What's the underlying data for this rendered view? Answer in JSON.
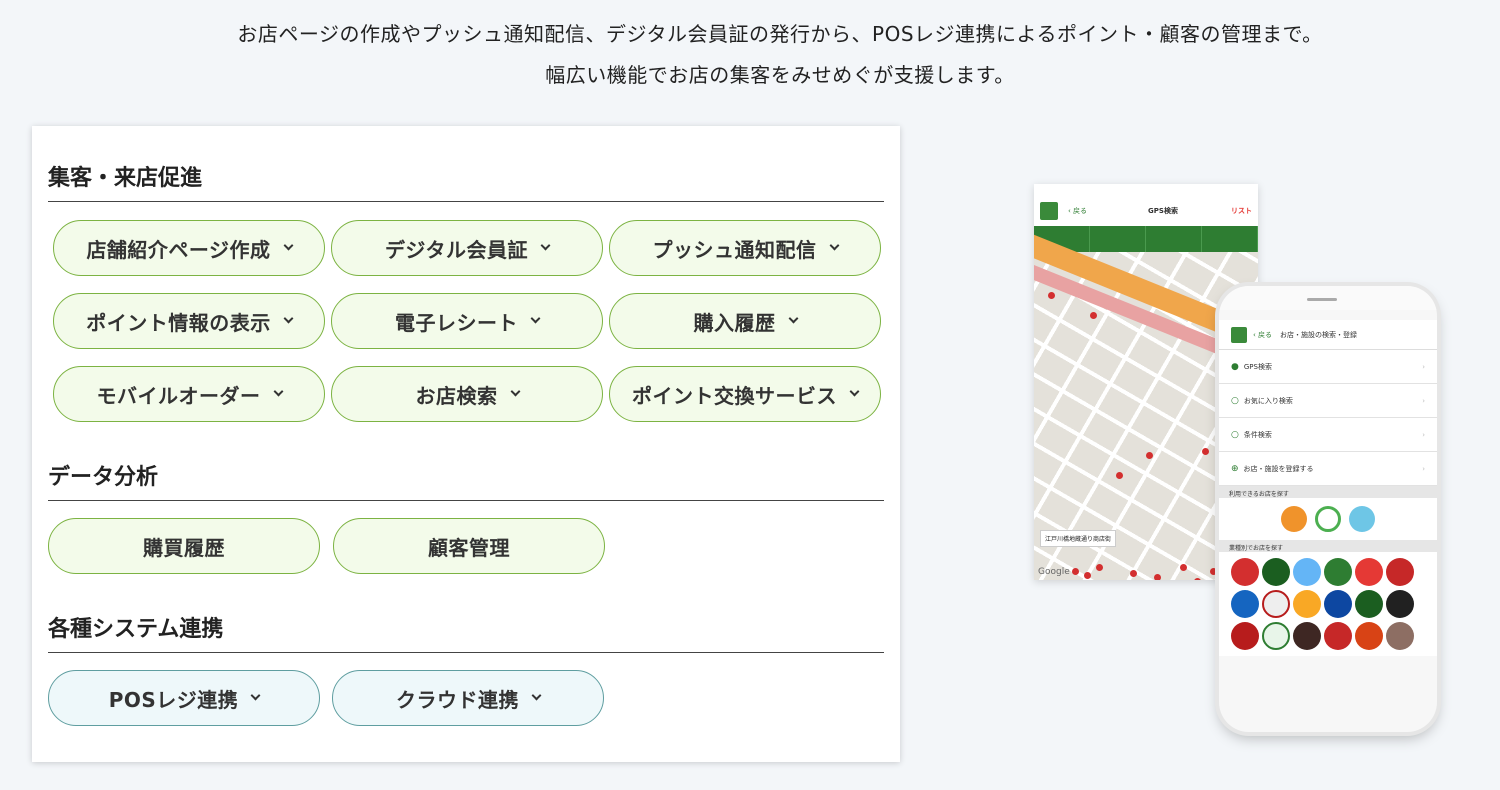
{
  "intro": {
    "line1": "お店ページの作成やプッシュ通知配信、デジタル会員証の発行から、POSレジ連携によるポイント・顧客の管理まで。",
    "line2": "幅広い機能でお店の集客をみせめぐが支援します。"
  },
  "sections": {
    "attract": {
      "title": "集客・来店促進",
      "items": [
        "店舗紹介ページ作成",
        "デジタル会員証",
        "プッシュ通知配信",
        "ポイント情報の表示",
        "電子レシート",
        "購入履歴",
        "モバイルオーダー",
        "お店検索",
        "ポイント交換サービス"
      ]
    },
    "analytics": {
      "title": "データ分析",
      "items": [
        "購買履歴",
        "顧客管理"
      ]
    },
    "integration": {
      "title": "各種システム連携",
      "items": [
        "POSレジ連携",
        "クラウド連携"
      ]
    }
  },
  "phone1": {
    "title": "GPS検索",
    "back": "戻る",
    "list": "リスト",
    "map_label": "江戸川橋地蔵通り商店街",
    "map_credit": "Google"
  },
  "phone2": {
    "back": "戻る",
    "title": "お店・施設の検索・登録",
    "rows": [
      "GPS検索",
      "お気に入り検索",
      "条件検索",
      "お店・施設を登録する"
    ],
    "section_payments": "利用できるお店を探す",
    "section_brands": "業種別でお店を探す"
  },
  "colors": {
    "pill_green_border": "#7cb342",
    "pill_green_bg": "#f3fbea",
    "pill_blue_border": "#5f9ea0",
    "pill_blue_bg": "#eef8fa",
    "app_green": "#2e7d32"
  }
}
